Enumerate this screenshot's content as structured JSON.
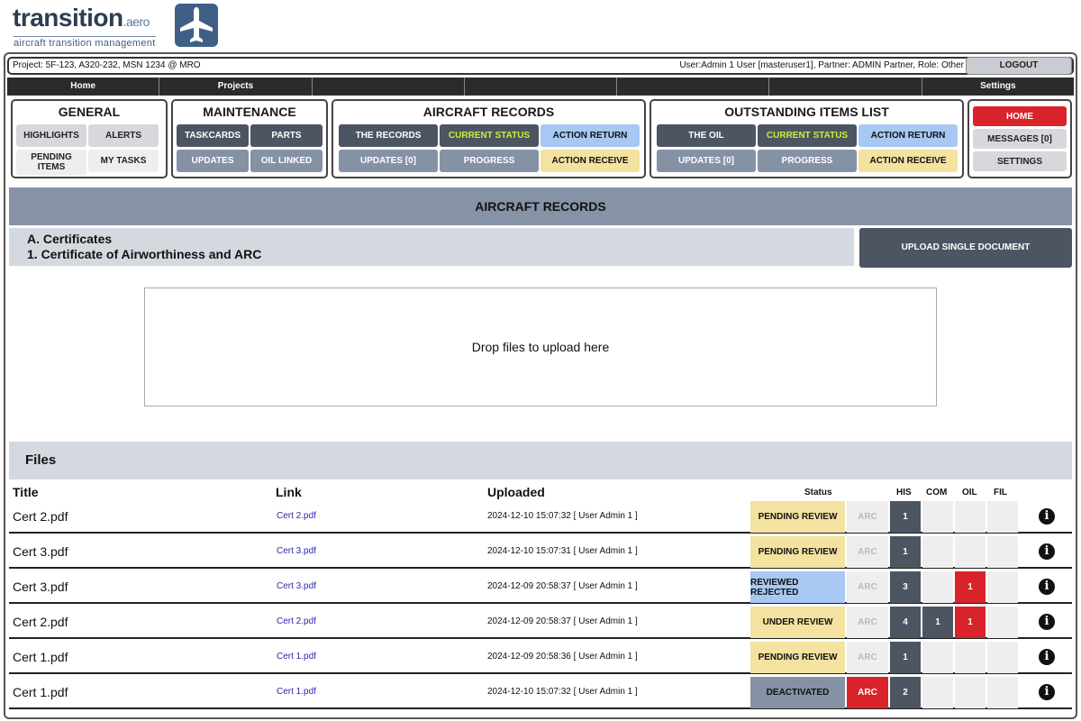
{
  "logo": {
    "word": "transition",
    "suffix": ".aero",
    "tagline": "aircraft transition management"
  },
  "project_bar": {
    "project": "Project: 5F-123, A320-232, MSN 1234 @ MRO",
    "user": "User:Admin 1 User [masteruser1], Partner: ADMIN Partner, Role: Other",
    "logout": "LOGOUT"
  },
  "nav": [
    "Home",
    "Projects",
    "",
    "",
    "",
    "",
    "Settings"
  ],
  "panels": {
    "general": {
      "title": "GENERAL",
      "highlights": "HIGHLIGHTS",
      "alerts": "ALERTS",
      "pending": "PENDING ITEMS",
      "my_tasks": "MY TASKS"
    },
    "maintenance": {
      "title": "MAINTENANCE",
      "taskcards": "TASKCARDS",
      "parts": "PARTS",
      "updates": "UPDATES",
      "oil_linked": "OIL LINKED"
    },
    "aircraft_records": {
      "title": "AIRCRAFT RECORDS",
      "the_records": "THE RECORDS",
      "current_status": "CURRENT STATUS",
      "action_return": "ACTION RETURN",
      "updates": "UPDATES [0]",
      "progress": "PROGRESS",
      "action_receive": "ACTION RECEIVE"
    },
    "oil": {
      "title": "OUTSTANDING ITEMS LIST",
      "the_oil": "THE OIL",
      "current_status": "CURRENT STATUS",
      "action_return": "ACTION RETURN",
      "updates": "UPDATES [0]",
      "progress": "PROGRESS",
      "action_receive": "ACTION RECEIVE"
    },
    "side": {
      "home": "HOME",
      "messages": "MESSAGES [0]",
      "settings": "SETTINGS"
    }
  },
  "section": {
    "title": "AIRCRAFT RECORDS",
    "cert_line1": "A. Certificates",
    "cert_line2": "1. Certificate of Airworthiness and ARC",
    "upload": "UPLOAD SINGLE DOCUMENT",
    "dropzone": "Drop files to upload here"
  },
  "files": {
    "title": "Files",
    "headers": {
      "title": "Title",
      "link": "Link",
      "uploaded": "Uploaded",
      "status": "Status",
      "his": "HIS",
      "com": "COM",
      "oil": "OIL",
      "fil": "FIL"
    },
    "rows": [
      {
        "title": "Cert 2.pdf",
        "link": "Cert 2.pdf",
        "uploaded": "2024-12-10 15:07:32 [ User Admin 1 ]",
        "status": "PENDING REVIEW",
        "status_style": "yellow",
        "arc": "ARC",
        "arc_active": false,
        "his": "1",
        "com": "",
        "oil": "",
        "fil": ""
      },
      {
        "title": "Cert 3.pdf",
        "link": "Cert 3.pdf",
        "uploaded": "2024-12-10 15:07:31 [ User Admin 1 ]",
        "status": "PENDING REVIEW",
        "status_style": "yellow",
        "arc": "ARC",
        "arc_active": false,
        "his": "1",
        "com": "",
        "oil": "",
        "fil": ""
      },
      {
        "title": "Cert 3.pdf",
        "link": "Cert 3.pdf",
        "uploaded": "2024-12-09 20:58:37 [ User Admin 1 ]",
        "status": "REVIEWED REJECTED",
        "status_style": "blue",
        "arc": "ARC",
        "arc_active": false,
        "his": "3",
        "com": "",
        "oil": "1",
        "fil": ""
      },
      {
        "title": "Cert 2.pdf",
        "link": "Cert 2.pdf",
        "uploaded": "2024-12-09 20:58:37 [ User Admin 1 ]",
        "status": "UNDER REVIEW",
        "status_style": "yellow",
        "arc": "ARC",
        "arc_active": false,
        "his": "4",
        "com": "1",
        "oil": "1",
        "fil": ""
      },
      {
        "title": "Cert 1.pdf",
        "link": "Cert 1.pdf",
        "uploaded": "2024-12-09 20:58:36 [ User Admin 1 ]",
        "status": "PENDING REVIEW",
        "status_style": "yellow",
        "arc": "ARC",
        "arc_active": false,
        "his": "1",
        "com": "",
        "oil": "",
        "fil": ""
      },
      {
        "title": "Cert 1.pdf",
        "link": "Cert 1.pdf",
        "uploaded": "2024-12-10 15:07:32 [ User Admin 1 ]",
        "status": "DEACTIVATED",
        "status_style": "gray",
        "arc": "ARC",
        "arc_active": true,
        "his": "2",
        "com": "",
        "oil": "",
        "fil": ""
      }
    ],
    "info_glyph": "i"
  },
  "colors": {
    "dark": "#4c5561",
    "slate": "#8592a6",
    "red": "#d9232a",
    "blue": "#a6c8f2",
    "yellow": "#f3e2a0",
    "lime": "#c7f03b"
  },
  "icons": {
    "logo": "airplane-icon",
    "info": "info-icon"
  }
}
